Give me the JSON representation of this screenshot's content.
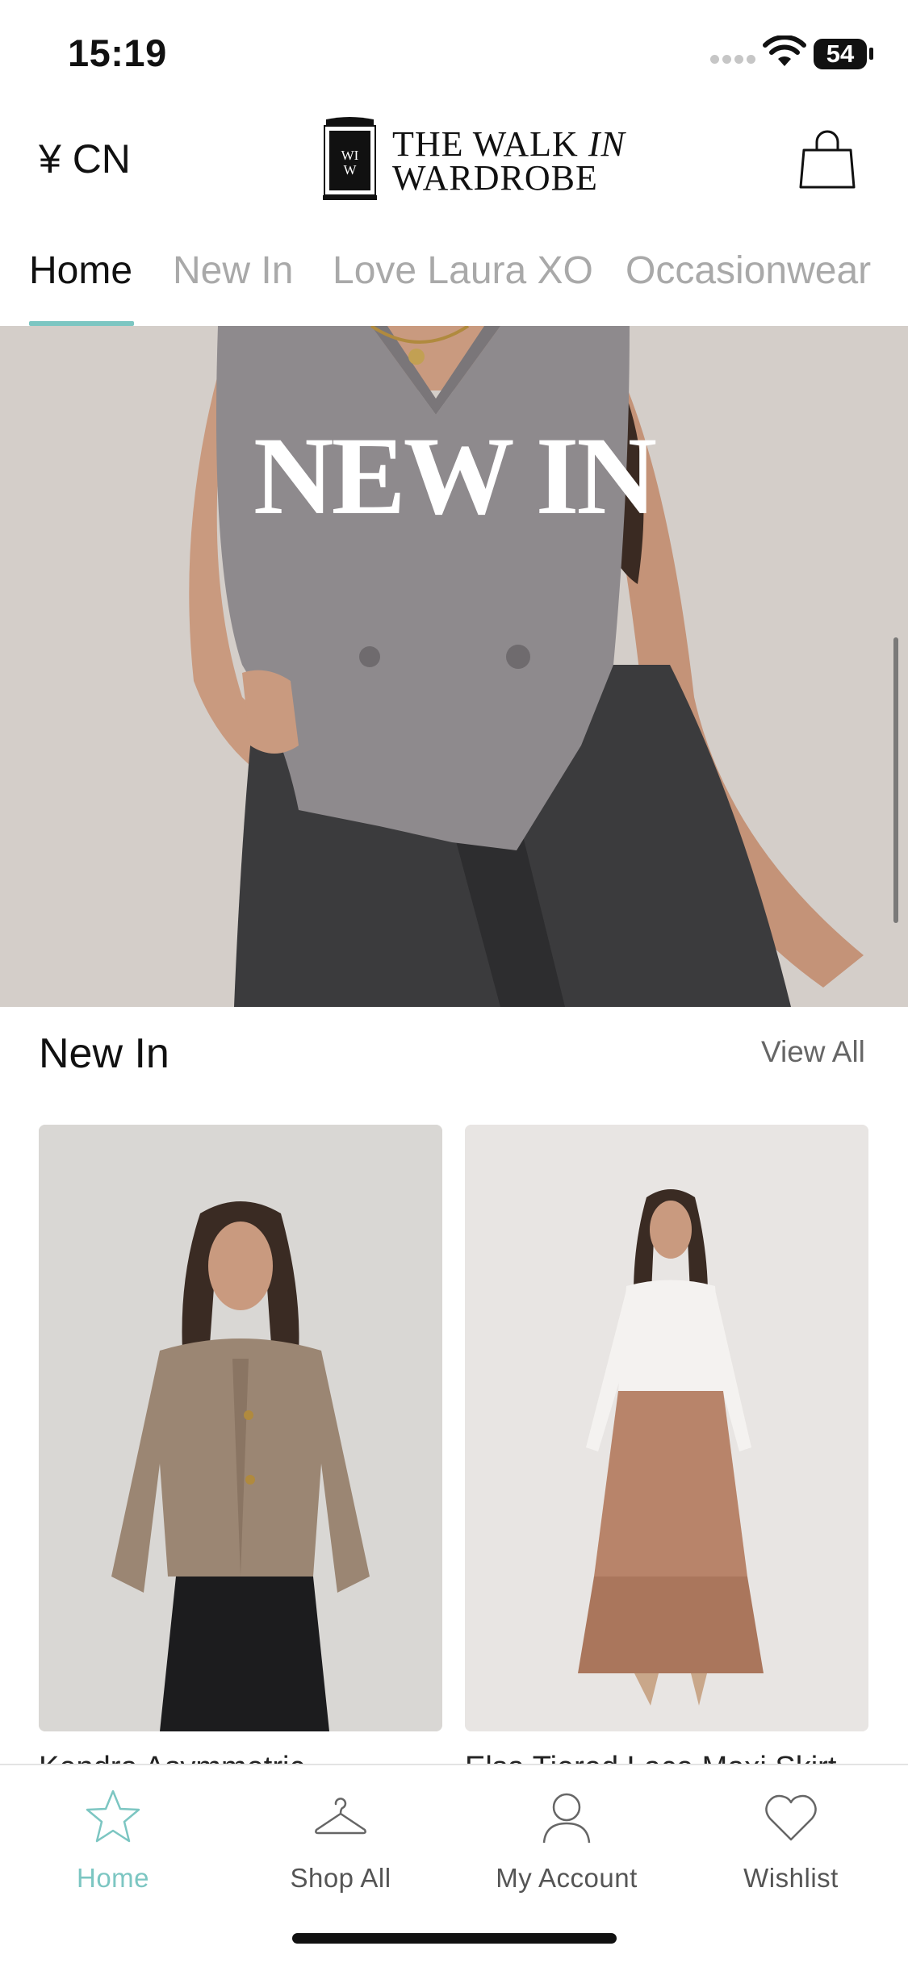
{
  "status_bar": {
    "time": "15:19",
    "battery": "54"
  },
  "header": {
    "currency": "¥ CN",
    "logo_line1": "THE WALK ",
    "logo_line1_italic": "IN",
    "logo_line2": "WARDROBE",
    "logo_mark": "WIW",
    "cart_icon": "shopping-bag-icon"
  },
  "tabs": [
    {
      "label": "Home",
      "active": true
    },
    {
      "label": "New In",
      "active": false
    },
    {
      "label": "Love Laura XO",
      "active": false
    },
    {
      "label": "Occasionwear",
      "active": false
    }
  ],
  "hero": {
    "title": "NEW IN"
  },
  "section": {
    "title": "New In",
    "view_all": "View All"
  },
  "products": [
    {
      "title": "Kendra Asymmetric..."
    },
    {
      "title": "Elsa Tiered Lace Maxi Skirt"
    }
  ],
  "bottom_nav": [
    {
      "label": "Home",
      "icon": "star-icon",
      "active": true
    },
    {
      "label": "Shop All",
      "icon": "hanger-icon",
      "active": false
    },
    {
      "label": "My Account",
      "icon": "user-icon",
      "active": false
    },
    {
      "label": "Wishlist",
      "icon": "heart-icon",
      "active": false
    }
  ],
  "colors": {
    "accent": "#7cc6c2",
    "hero_bg": "#d8d3cf"
  }
}
